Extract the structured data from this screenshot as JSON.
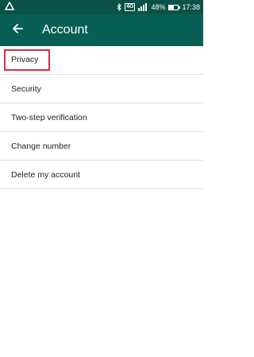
{
  "status_bar": {
    "left_icon": "drive-icon",
    "network": "4G",
    "battery_percent": "48%",
    "battery_level": 0.48,
    "time": "17:38"
  },
  "toolbar": {
    "back_icon": "arrow-left-icon",
    "title": "Account"
  },
  "menu": {
    "items": [
      {
        "label": "Privacy"
      },
      {
        "label": "Security"
      },
      {
        "label": "Two-step verification"
      },
      {
        "label": "Change number"
      },
      {
        "label": "Delete my account"
      }
    ]
  },
  "colors": {
    "status_bar": "#0a5247",
    "toolbar": "#075e54",
    "highlight_box": "#d32f3f"
  }
}
